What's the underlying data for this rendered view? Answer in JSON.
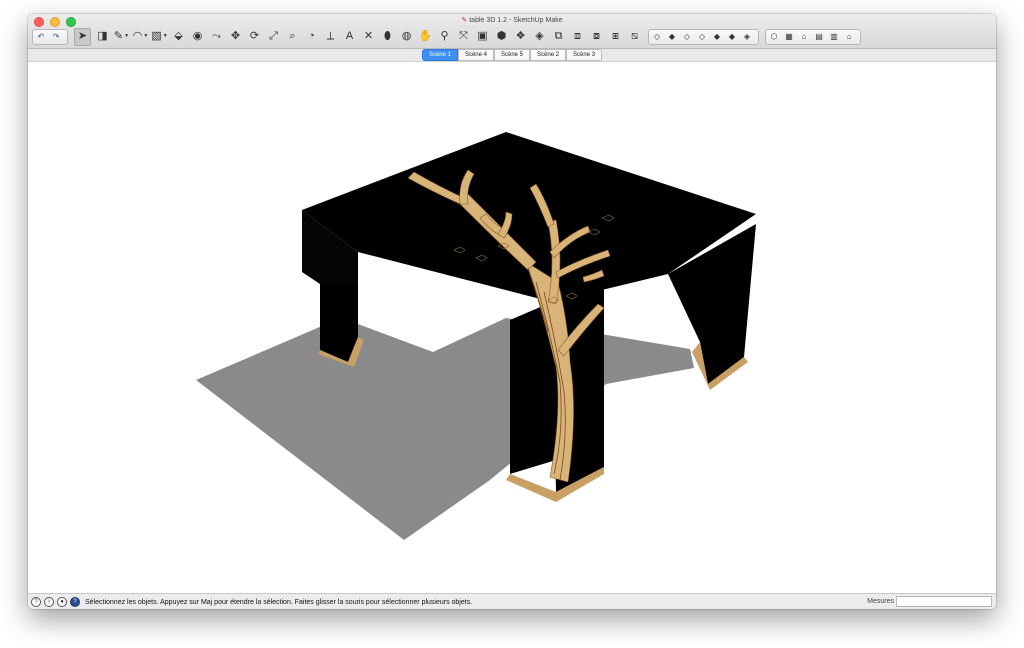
{
  "window": {
    "title": "table 3D 1.2 - SketchUp Make",
    "title_icon": "sketchup-doc-icon"
  },
  "toolbar": {
    "undo_group": [
      {
        "name": "undo-icon",
        "glyph": "↶"
      },
      {
        "name": "redo-icon",
        "glyph": "↷"
      }
    ],
    "tools": [
      {
        "name": "select-tool",
        "glyph": "➤",
        "active": true
      },
      {
        "name": "eraser-tool",
        "glyph": "◨"
      },
      {
        "name": "line-tool",
        "glyph": "✎",
        "dropdown": true
      },
      {
        "name": "arc-tool",
        "glyph": "◠",
        "dropdown": true
      },
      {
        "name": "shape-tool",
        "glyph": "▧",
        "dropdown": true
      },
      {
        "name": "push-pull-tool",
        "glyph": "⬙"
      },
      {
        "name": "offset-tool",
        "glyph": "◉"
      },
      {
        "name": "follow-me-tool",
        "glyph": "⤳"
      },
      {
        "name": "move-tool",
        "glyph": "✥"
      },
      {
        "name": "rotate-tool",
        "glyph": "⟳"
      },
      {
        "name": "scale-tool",
        "glyph": "⤢"
      },
      {
        "name": "tape-measure-tool",
        "glyph": "⌕"
      },
      {
        "name": "protractor-tool",
        "glyph": "◔"
      },
      {
        "name": "dimension-tool",
        "glyph": "⟂"
      },
      {
        "name": "text-tool",
        "glyph": "A"
      },
      {
        "name": "axes-tool",
        "glyph": "✕"
      },
      {
        "name": "paint-bucket-tool",
        "glyph": "⬮"
      },
      {
        "name": "orbit-tool",
        "glyph": "◍"
      },
      {
        "name": "pan-tool",
        "glyph": "✋"
      },
      {
        "name": "zoom-tool",
        "glyph": "⚲"
      },
      {
        "name": "zoom-extents-tool",
        "glyph": "⤧"
      },
      {
        "name": "warehouse-tool",
        "glyph": "▣"
      },
      {
        "name": "extension-warehouse-tool",
        "glyph": "⬢"
      },
      {
        "name": "components-tool",
        "glyph": "❖"
      },
      {
        "name": "photo-textures-tool",
        "glyph": "◈"
      },
      {
        "name": "share-model-tool",
        "glyph": "⧉"
      },
      {
        "name": "layout-tool",
        "glyph": "⧈"
      },
      {
        "name": "section-plane-tool",
        "glyph": "⧇"
      },
      {
        "name": "section-display-tool",
        "glyph": "⧆"
      },
      {
        "name": "section-cut-tool",
        "glyph": "⧅"
      }
    ],
    "style_group": [
      {
        "name": "xray-style-icon",
        "glyph": "◇"
      },
      {
        "name": "back-edges-style-icon",
        "glyph": "◆"
      },
      {
        "name": "wireframe-style-icon",
        "glyph": "◇"
      },
      {
        "name": "hidden-line-style-icon",
        "glyph": "◇"
      },
      {
        "name": "shaded-style-icon",
        "glyph": "◆"
      },
      {
        "name": "shaded-textures-style-icon",
        "glyph": "◆"
      },
      {
        "name": "monochrome-style-icon",
        "glyph": "◈"
      }
    ],
    "view_group": [
      {
        "name": "iso-view-icon",
        "glyph": "⬡"
      },
      {
        "name": "top-view-icon",
        "glyph": "▦"
      },
      {
        "name": "front-view-icon",
        "glyph": "⌂"
      },
      {
        "name": "right-view-icon",
        "glyph": "▤"
      },
      {
        "name": "back-view-icon",
        "glyph": "▥"
      },
      {
        "name": "left-view-icon",
        "glyph": "⌂"
      }
    ]
  },
  "scenes": [
    {
      "label": "Scène 1",
      "active": true
    },
    {
      "label": "Scène 4",
      "active": false
    },
    {
      "label": "Scène 5",
      "active": false
    },
    {
      "label": "Scène 2",
      "active": false
    },
    {
      "label": "Scène 3",
      "active": false
    }
  ],
  "statusbar": {
    "icons": [
      {
        "name": "geo-location-icon",
        "glyph": "?"
      },
      {
        "name": "credits-icon",
        "glyph": "i"
      },
      {
        "name": "user-account-icon",
        "glyph": "●"
      },
      {
        "name": "help-icon",
        "glyph": "?"
      }
    ],
    "message": "Sélectionnez les objets. Appuyez sur Maj pour étendre la sélection. Faites glisser la souris pour sélectionner plusieurs objets.",
    "measure_label": "Mesures",
    "measure_value": ""
  }
}
